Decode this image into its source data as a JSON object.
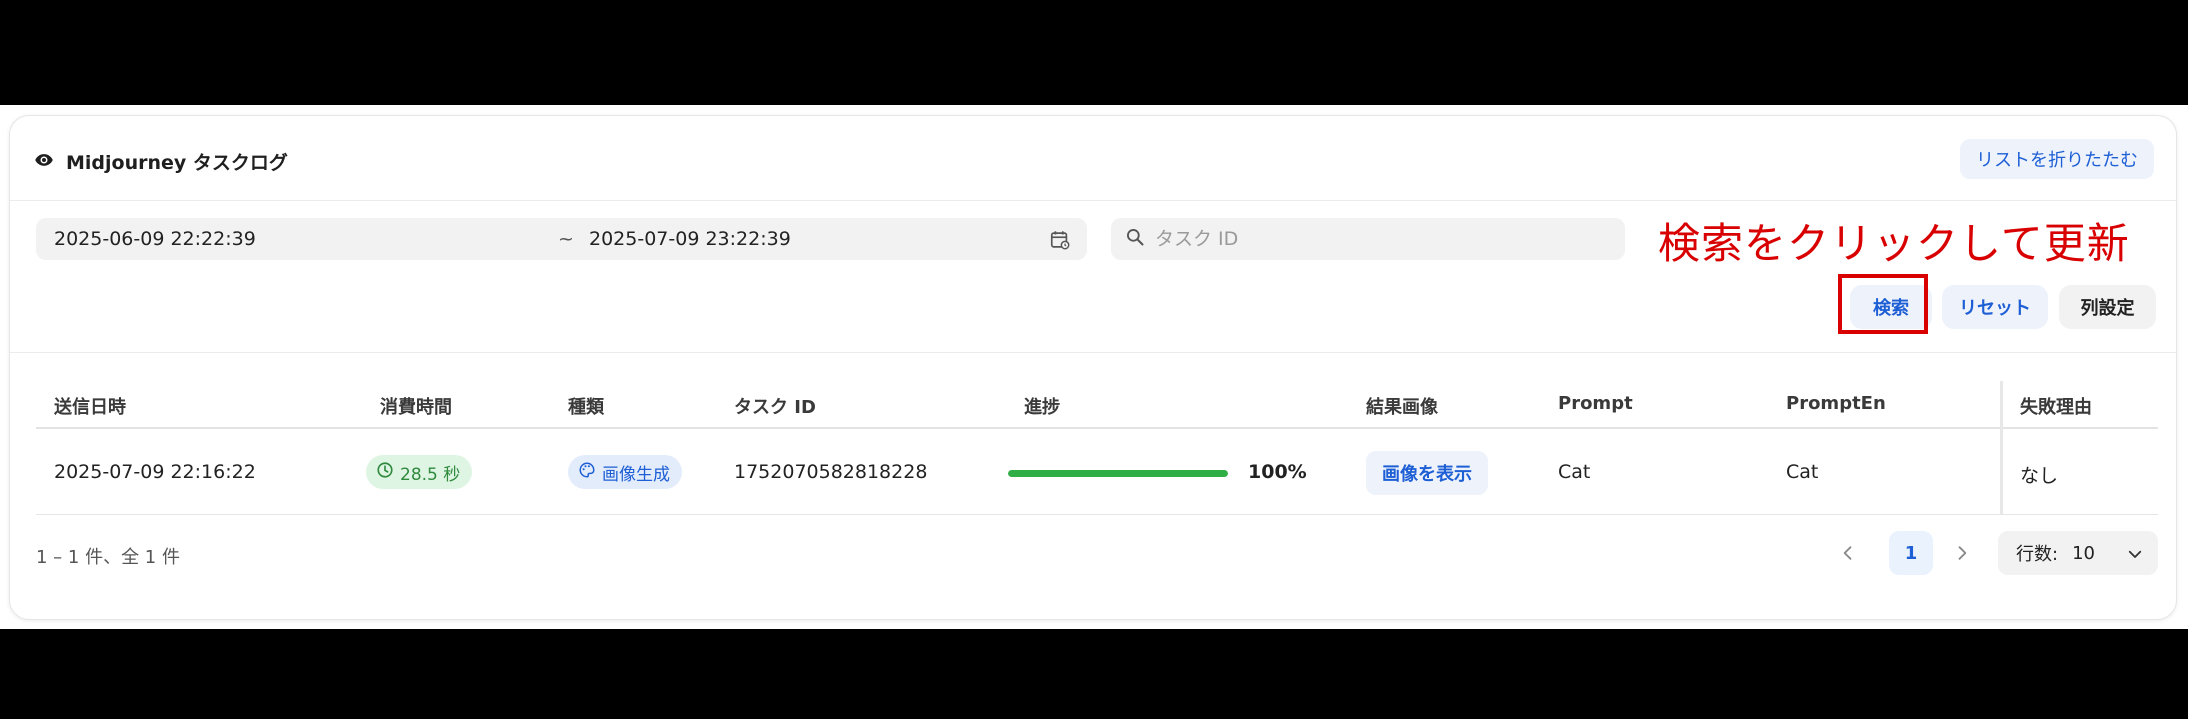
{
  "header": {
    "title": "Midjourney タスクログ",
    "collapse_label": "リストを折りたたむ"
  },
  "filters": {
    "date_start": "2025-06-09 22:22:39",
    "date_separator": "~",
    "date_end": "2025-07-09 23:22:39",
    "search_placeholder": "タスク ID",
    "search_value": ""
  },
  "annotation": {
    "text": "検索をクリックして更新",
    "color": "#d80000"
  },
  "actions": {
    "search_label": "検索",
    "reset_label": "リセット",
    "columns_label": "列設定"
  },
  "table": {
    "columns": [
      "送信日時",
      "消費時間",
      "種類",
      "タスク ID",
      "進捗",
      "結果画像",
      "Prompt",
      "PromptEn",
      "失敗理由"
    ],
    "rows": [
      {
        "submitted": "2025-07-09 22:16:22",
        "duration": "28.5 秒",
        "type": "画像生成",
        "task_id": "1752070582818228",
        "progress": 100,
        "progress_label": "100%",
        "result_label": "画像を表示",
        "prompt": "Cat",
        "prompt_en": "Cat",
        "fail_reason": "なし"
      }
    ]
  },
  "footer": {
    "summary": "1 – 1 件、全 1 件",
    "current_page": "1",
    "rows_label": "行数:",
    "rows_value": "10"
  },
  "icons": {
    "title": "eye-icon",
    "calendar": "calendar-icon",
    "search": "search-icon",
    "duration": "clock-icon",
    "type": "palette-icon",
    "prev": "chevron-left-icon",
    "next": "chevron-right-icon",
    "select": "chevron-down-icon"
  },
  "colors": {
    "accent": "#1e5fd6",
    "progress": "#2fae45",
    "duration_badge_bg": "#dff5e3",
    "type_badge_bg": "#e3ecfb"
  }
}
